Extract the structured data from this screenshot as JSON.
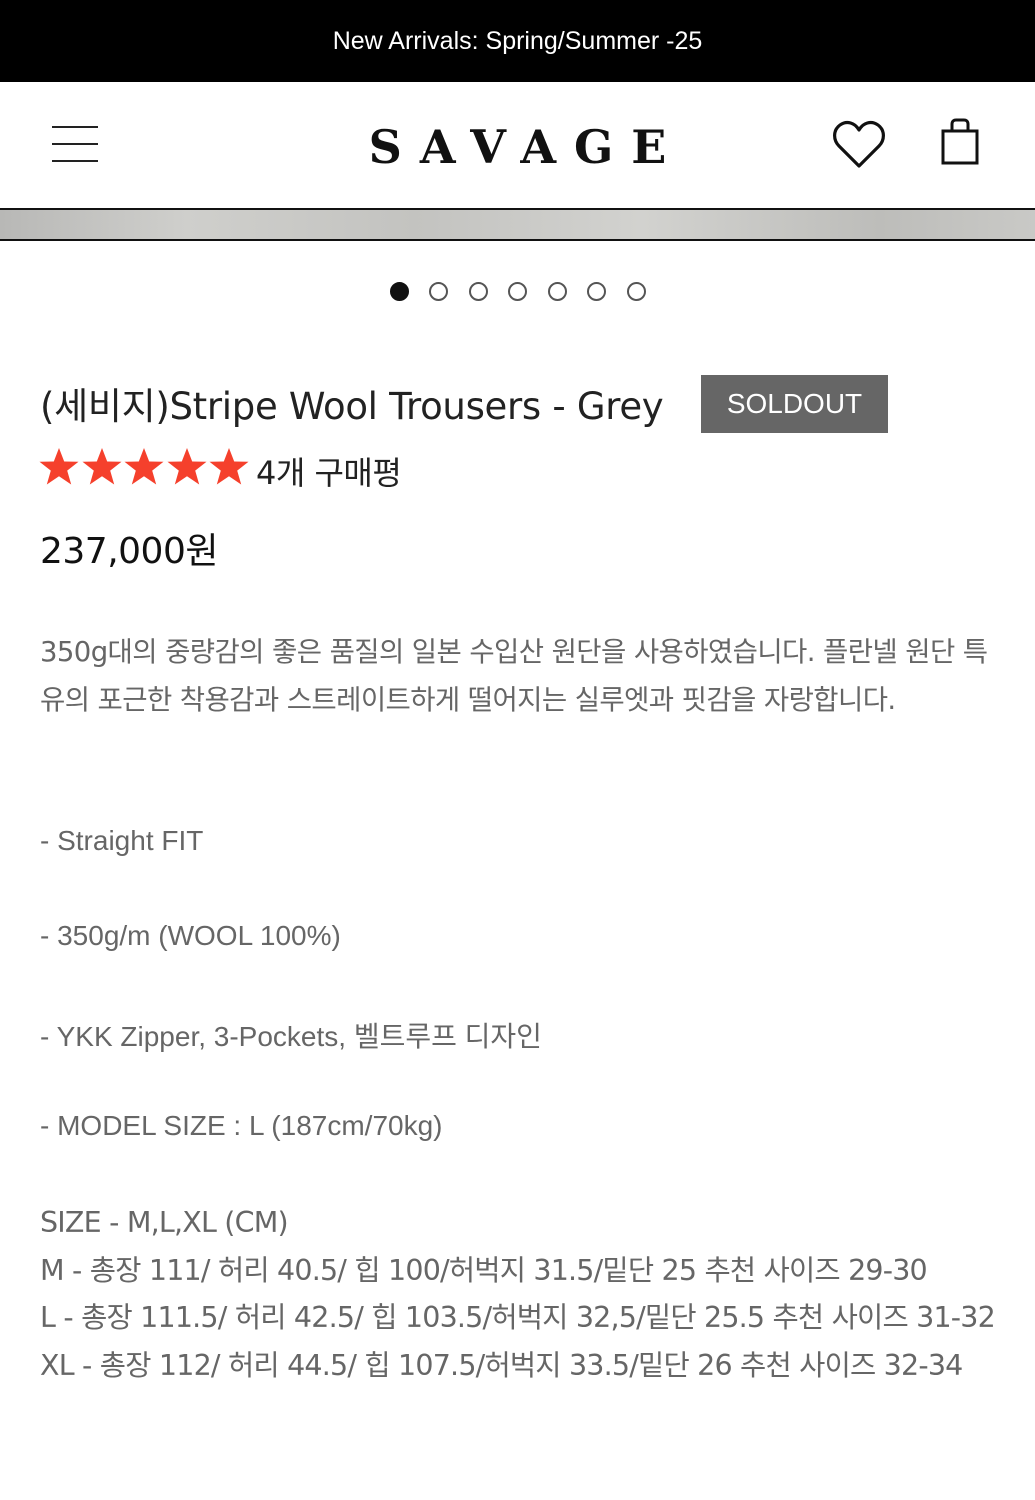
{
  "announcement": "New Arrivals: Spring/Summer -25",
  "header": {
    "logo": "SAVAGE"
  },
  "carousel": {
    "total_slides": 7,
    "active_slide": 1
  },
  "product": {
    "title": "(세비지)Stripe Wool Trousers - Grey",
    "badge": "SOLDOUT",
    "rating": 5,
    "reviews": "4개 구매평",
    "price": "237,000원",
    "star_color": "#f5402c"
  },
  "description": {
    "intro": "350g대의 중량감의 좋은 품질의 일본 수입산 원단을 사용하였습니다. 플란넬 원단 특유의 포근한 착용감과 스트레이트하게 떨어지는 실루엣과 핏감을 자랑합니다.",
    "features": [
      "- Straight FIT",
      "- 350g/m (WOOL 100%)",
      "- YKK Zipper, 3-Pockets, 벨트루프 디자인",
      "- MODEL SIZE : L (187cm/70kg)"
    ],
    "size_header": "SIZE - M,L,XL (CM)",
    "sizes": [
      "M - 총장 111/ 허리 40.5/ 힙 100/허벅지 31.5/밑단 25 추천 사이즈 29-30",
      "L - 총장 111.5/ 허리 42.5/ 힙 103.5/허벅지 32,5/밑단 25.5 추천 사이즈 31-32",
      "XL - 총장 112/ 허리 44.5/ 힙 107.5/허벅지 33.5/밑단 26  추천 사이즈 32-34"
    ]
  }
}
